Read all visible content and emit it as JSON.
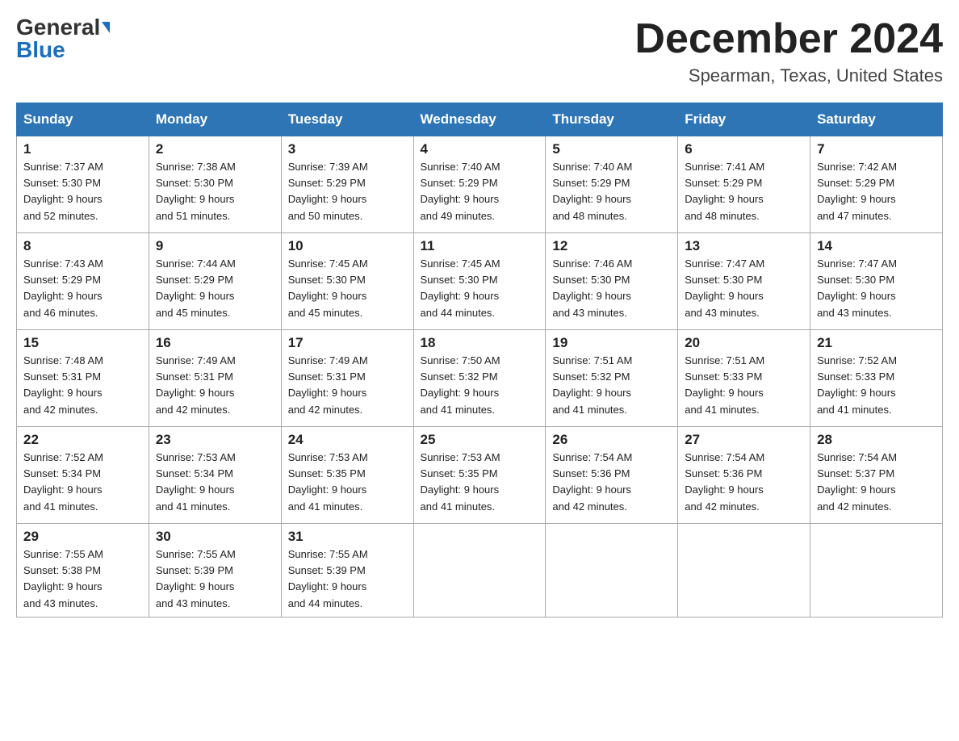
{
  "logo": {
    "general": "General",
    "blue": "Blue"
  },
  "title": {
    "month": "December 2024",
    "location": "Spearman, Texas, United States"
  },
  "headers": [
    "Sunday",
    "Monday",
    "Tuesday",
    "Wednesday",
    "Thursday",
    "Friday",
    "Saturday"
  ],
  "weeks": [
    [
      {
        "day": "1",
        "sunrise": "7:37 AM",
        "sunset": "5:30 PM",
        "daylight": "9 hours and 52 minutes."
      },
      {
        "day": "2",
        "sunrise": "7:38 AM",
        "sunset": "5:30 PM",
        "daylight": "9 hours and 51 minutes."
      },
      {
        "day": "3",
        "sunrise": "7:39 AM",
        "sunset": "5:29 PM",
        "daylight": "9 hours and 50 minutes."
      },
      {
        "day": "4",
        "sunrise": "7:40 AM",
        "sunset": "5:29 PM",
        "daylight": "9 hours and 49 minutes."
      },
      {
        "day": "5",
        "sunrise": "7:40 AM",
        "sunset": "5:29 PM",
        "daylight": "9 hours and 48 minutes."
      },
      {
        "day": "6",
        "sunrise": "7:41 AM",
        "sunset": "5:29 PM",
        "daylight": "9 hours and 48 minutes."
      },
      {
        "day": "7",
        "sunrise": "7:42 AM",
        "sunset": "5:29 PM",
        "daylight": "9 hours and 47 minutes."
      }
    ],
    [
      {
        "day": "8",
        "sunrise": "7:43 AM",
        "sunset": "5:29 PM",
        "daylight": "9 hours and 46 minutes."
      },
      {
        "day": "9",
        "sunrise": "7:44 AM",
        "sunset": "5:29 PM",
        "daylight": "9 hours and 45 minutes."
      },
      {
        "day": "10",
        "sunrise": "7:45 AM",
        "sunset": "5:30 PM",
        "daylight": "9 hours and 45 minutes."
      },
      {
        "day": "11",
        "sunrise": "7:45 AM",
        "sunset": "5:30 PM",
        "daylight": "9 hours and 44 minutes."
      },
      {
        "day": "12",
        "sunrise": "7:46 AM",
        "sunset": "5:30 PM",
        "daylight": "9 hours and 43 minutes."
      },
      {
        "day": "13",
        "sunrise": "7:47 AM",
        "sunset": "5:30 PM",
        "daylight": "9 hours and 43 minutes."
      },
      {
        "day": "14",
        "sunrise": "7:47 AM",
        "sunset": "5:30 PM",
        "daylight": "9 hours and 43 minutes."
      }
    ],
    [
      {
        "day": "15",
        "sunrise": "7:48 AM",
        "sunset": "5:31 PM",
        "daylight": "9 hours and 42 minutes."
      },
      {
        "day": "16",
        "sunrise": "7:49 AM",
        "sunset": "5:31 PM",
        "daylight": "9 hours and 42 minutes."
      },
      {
        "day": "17",
        "sunrise": "7:49 AM",
        "sunset": "5:31 PM",
        "daylight": "9 hours and 42 minutes."
      },
      {
        "day": "18",
        "sunrise": "7:50 AM",
        "sunset": "5:32 PM",
        "daylight": "9 hours and 41 minutes."
      },
      {
        "day": "19",
        "sunrise": "7:51 AM",
        "sunset": "5:32 PM",
        "daylight": "9 hours and 41 minutes."
      },
      {
        "day": "20",
        "sunrise": "7:51 AM",
        "sunset": "5:33 PM",
        "daylight": "9 hours and 41 minutes."
      },
      {
        "day": "21",
        "sunrise": "7:52 AM",
        "sunset": "5:33 PM",
        "daylight": "9 hours and 41 minutes."
      }
    ],
    [
      {
        "day": "22",
        "sunrise": "7:52 AM",
        "sunset": "5:34 PM",
        "daylight": "9 hours and 41 minutes."
      },
      {
        "day": "23",
        "sunrise": "7:53 AM",
        "sunset": "5:34 PM",
        "daylight": "9 hours and 41 minutes."
      },
      {
        "day": "24",
        "sunrise": "7:53 AM",
        "sunset": "5:35 PM",
        "daylight": "9 hours and 41 minutes."
      },
      {
        "day": "25",
        "sunrise": "7:53 AM",
        "sunset": "5:35 PM",
        "daylight": "9 hours and 41 minutes."
      },
      {
        "day": "26",
        "sunrise": "7:54 AM",
        "sunset": "5:36 PM",
        "daylight": "9 hours and 42 minutes."
      },
      {
        "day": "27",
        "sunrise": "7:54 AM",
        "sunset": "5:36 PM",
        "daylight": "9 hours and 42 minutes."
      },
      {
        "day": "28",
        "sunrise": "7:54 AM",
        "sunset": "5:37 PM",
        "daylight": "9 hours and 42 minutes."
      }
    ],
    [
      {
        "day": "29",
        "sunrise": "7:55 AM",
        "sunset": "5:38 PM",
        "daylight": "9 hours and 43 minutes."
      },
      {
        "day": "30",
        "sunrise": "7:55 AM",
        "sunset": "5:39 PM",
        "daylight": "9 hours and 43 minutes."
      },
      {
        "day": "31",
        "sunrise": "7:55 AM",
        "sunset": "5:39 PM",
        "daylight": "9 hours and 44 minutes."
      },
      null,
      null,
      null,
      null
    ]
  ],
  "labels": {
    "sunrise": "Sunrise:",
    "sunset": "Sunset:",
    "daylight": "Daylight:"
  }
}
